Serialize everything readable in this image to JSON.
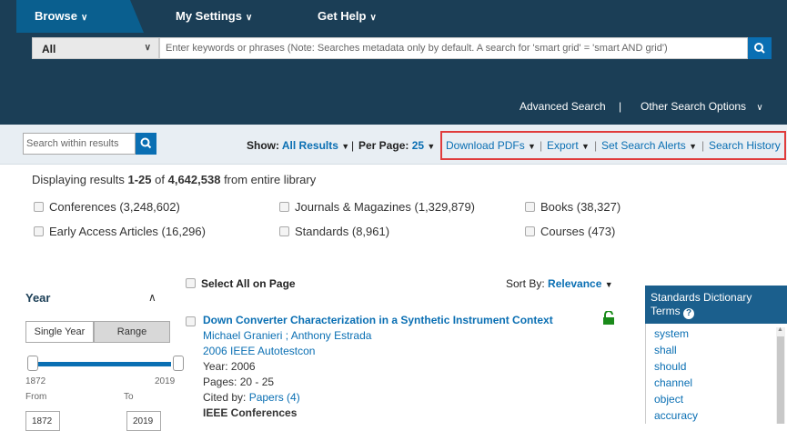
{
  "nav": {
    "browse": "Browse",
    "settings": "My Settings",
    "help": "Get Help"
  },
  "search": {
    "scope": "All",
    "placeholder": "Enter keywords or phrases (Note: Searches metadata only by default. A search for 'smart grid' = 'smart AND grid')",
    "advanced": "Advanced Search",
    "divider": "|",
    "other": "Other Search Options"
  },
  "toolbar": {
    "within_placeholder": "Search within results",
    "show_label": "Show:",
    "show_value": "All Results",
    "per_page_label": "Per Page:",
    "per_page_value": "25",
    "bar": "|",
    "download": "Download PDFs",
    "export": "Export",
    "alerts": "Set Search Alerts",
    "history": "Search History"
  },
  "summary": {
    "prefix": "Displaying results ",
    "range": "1-25",
    "of": " of ",
    "total": "4,642,538",
    "suffix": " from entire library"
  },
  "facets": [
    "Conferences (3,248,602)",
    "Journals & Magazines (1,329,879)",
    "Books (38,327)",
    "Early Access Articles (16,296)",
    "Standards (8,961)",
    "Courses (473)"
  ],
  "year": {
    "title": "Year",
    "single": "Single Year",
    "range": "Range",
    "min": "1872",
    "max": "2019",
    "from_label": "From",
    "to_label": "To",
    "from_value": "1872",
    "to_value": "2019"
  },
  "results": {
    "select_all": "Select All on Page",
    "sort_label": "Sort By:",
    "sort_value": "Relevance",
    "item": {
      "title": "Down Converter Characterization in a Synthetic Instrument Context",
      "authors": "Michael Granieri ; Anthony Estrada",
      "venue": "2006 IEEE Autotestcon",
      "year": "Year: 2006",
      "pages": "Pages: 20 - 25",
      "cited_prefix": "Cited by: ",
      "cited_link": "Papers (4)",
      "publisher": "IEEE Conferences"
    }
  },
  "dictionary": {
    "title": "Standards Dictionary Terms",
    "terms": [
      "system",
      "shall",
      "should",
      "channel",
      "object",
      "accuracy"
    ]
  }
}
